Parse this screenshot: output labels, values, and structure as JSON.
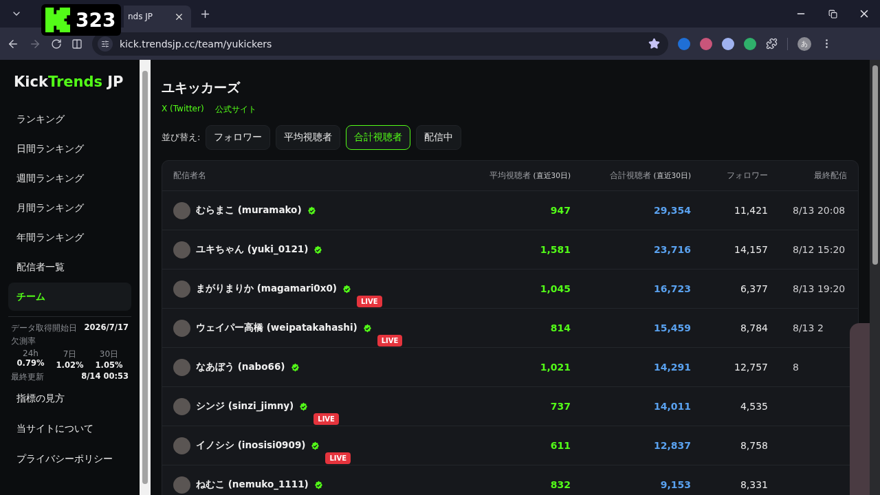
{
  "browser": {
    "tab_title": "nds JP",
    "url": "kick.trendsjp.cc/team/yukickers",
    "profile": "あ"
  },
  "overlay": {
    "viewer_count": "323"
  },
  "sidebar": {
    "logo": [
      {
        "text": "Kick",
        "highlight": false
      },
      {
        "text": "Trends",
        "highlight": true
      },
      {
        "text": " JP",
        "highlight": false
      }
    ],
    "nav": [
      {
        "label": "ランキング",
        "selected": false
      },
      {
        "label": "日間ランキング",
        "selected": false
      },
      {
        "label": "週間ランキング",
        "selected": false
      },
      {
        "label": "月間ランキング",
        "selected": false
      },
      {
        "label": "年間ランキング",
        "selected": false
      },
      {
        "label": "配信者一覧",
        "selected": false
      },
      {
        "label": "チーム",
        "selected": true
      }
    ],
    "stats": {
      "start_label": "データ取得開始日",
      "start_value": "2026/7/17",
      "missing_label": "欠測率",
      "missing": [
        {
          "label": "24h",
          "value": "0.79%"
        },
        {
          "label": "7日",
          "value": "1.02%"
        },
        {
          "label": "30日",
          "value": "1.05%"
        }
      ],
      "updated_label": "最終更新",
      "updated_value": "8/14 00:53"
    },
    "footer_links": [
      "指標の見方",
      "当サイトについて",
      "プライバシーポリシー"
    ]
  },
  "main": {
    "title": "ユキッカーズ",
    "links": [
      "X (Twitter)",
      "公式サイト"
    ],
    "sort_label": "並び替え:",
    "sort_options": [
      {
        "label": "フォロワー",
        "selected": false
      },
      {
        "label": "平均視聴者",
        "selected": false
      },
      {
        "label": "合計視聴者",
        "selected": true
      },
      {
        "label": "配信中",
        "selected": false
      }
    ],
    "table": {
      "columns": [
        {
          "label": "配信者名"
        },
        {
          "label": "平均視聴者",
          "note": "(直近30日)"
        },
        {
          "label": "合計視聴者",
          "note": "(直近30日)"
        },
        {
          "label": "フォロワー"
        },
        {
          "label": "最終配信"
        }
      ],
      "rows": [
        {
          "name": "むらまこ (muramako)",
          "verified": true,
          "live": false,
          "avg": "947",
          "total": "29,354",
          "followers": "11,421",
          "last": "8/13 20:08"
        },
        {
          "name": "ユキちゃん (yuki_0121)",
          "verified": true,
          "live": false,
          "avg": "1,581",
          "total": "23,716",
          "followers": "14,157",
          "last": "8/12 15:20"
        },
        {
          "name": "まがりまりか (magamari0x0)",
          "verified": true,
          "live": true,
          "live_label": "LIVE",
          "avg": "1,045",
          "total": "16,723",
          "followers": "6,377",
          "last": "8/13 19:20"
        },
        {
          "name": "ウェイパー高橋 (weipatakahashi)",
          "verified": true,
          "live": true,
          "live_label": "LIVE",
          "avg": "814",
          "total": "15,459",
          "followers": "8,784",
          "last": "8/13 2"
        },
        {
          "name": "なあぼう (nabo66)",
          "verified": true,
          "live": false,
          "avg": "1,021",
          "total": "14,291",
          "followers": "12,757",
          "last": "8"
        },
        {
          "name": "シンジ (sinzi_jimny)",
          "verified": true,
          "live": true,
          "live_label": "LIVE",
          "avg": "737",
          "total": "14,011",
          "followers": "4,535"
        },
        {
          "name": "イノシシ (inosisi0909)",
          "verified": true,
          "live": true,
          "live_label": "LIVE",
          "avg": "611",
          "total": "12,837",
          "followers": "8,758"
        },
        {
          "name": "ねむこ (nemuko_1111)",
          "verified": true,
          "live": false,
          "avg": "832",
          "total": "9,153",
          "followers": "8,331"
        }
      ]
    }
  }
}
